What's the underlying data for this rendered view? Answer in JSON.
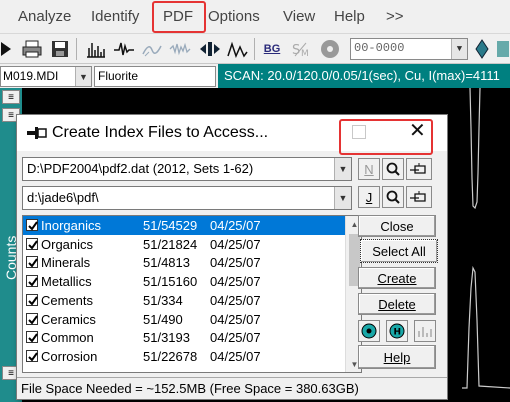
{
  "menu": {
    "items": [
      "Analyze",
      "Identify",
      "PDF",
      "Options",
      "View",
      "Help",
      ">>"
    ]
  },
  "toolbar": {
    "buttons": [
      "printer-icon",
      "save-icon",
      "histogram-icon",
      "peak-icon",
      "smooth-icon",
      "noise-icon",
      "arrows-icon",
      "peaks-icon",
      "bg-button",
      "strip-icon",
      "disc-icon"
    ],
    "bg_label": "BG",
    "angle_value": "00-0000"
  },
  "file_bar": {
    "file_name": "M019.MDI",
    "phase_name": "Fluorite",
    "scan_info": "SCAN: 20.0/120.0/0.05/1(sec), Cu, I(max)=4111"
  },
  "side": {
    "label": "Counts"
  },
  "dialog": {
    "title": "Create Index Files to Access...",
    "pdf_path": "D:\\PDF2004\\pdf2.dat (2012, Sets 1-62)",
    "index_path": "d:\\jade6\\pdf\\",
    "n_label": "N",
    "j_label": "J",
    "rows": [
      {
        "name": "Inorganics",
        "sets": "51/54529",
        "date": "04/25/07",
        "checked": true,
        "selected": true
      },
      {
        "name": "Organics",
        "sets": "51/21824",
        "date": "04/25/07",
        "checked": true,
        "selected": false
      },
      {
        "name": "Minerals",
        "sets": "51/4813",
        "date": "04/25/07",
        "checked": true,
        "selected": false
      },
      {
        "name": "Metallics",
        "sets": "51/15160",
        "date": "04/25/07",
        "checked": true,
        "selected": false
      },
      {
        "name": "Cements",
        "sets": "51/334",
        "date": "04/25/07",
        "checked": true,
        "selected": false
      },
      {
        "name": "Ceramics",
        "sets": "51/490",
        "date": "04/25/07",
        "checked": true,
        "selected": false
      },
      {
        "name": "Common",
        "sets": "51/3193",
        "date": "04/25/07",
        "checked": true,
        "selected": false
      },
      {
        "name": "Corrosion",
        "sets": "51/22678",
        "date": "04/25/07",
        "checked": true,
        "selected": false
      }
    ],
    "buttons": {
      "close": "Close",
      "select_all": "Select All",
      "create": "Create",
      "delete": "Delete",
      "help": "Help"
    },
    "status": "File Space Needed = ~152.5MB (Free Space = 380.63GB)"
  },
  "colors": {
    "highlight_red": "#e53333",
    "selection_blue": "#0078d7",
    "teal": "#008080"
  }
}
